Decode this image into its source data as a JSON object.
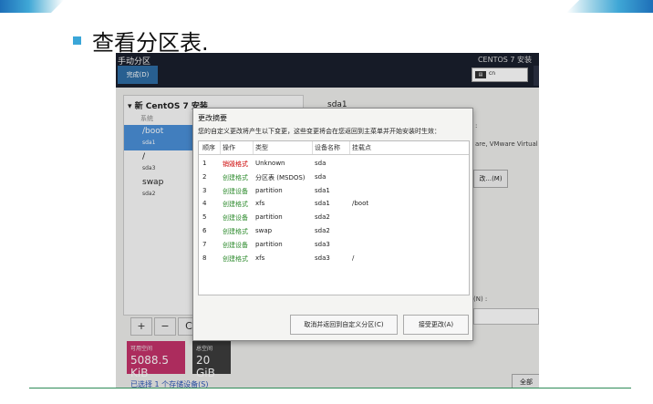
{
  "slide": {
    "title": "查看分区表."
  },
  "installer": {
    "window_title": "手动分区",
    "done_label": "完成(D)",
    "product": "CENTOS 7 安装",
    "keyboard": {
      "icon": "keyboard-icon",
      "layout": "cn"
    },
    "left_panel": {
      "header": "▾ 新 CentOS 7 安装",
      "system_label": "系统",
      "mountpoints": [
        {
          "name": "/boot",
          "device": "sda1",
          "selected": true
        },
        {
          "name": "/",
          "device": "sda3",
          "selected": false
        },
        {
          "name": "swap",
          "device": "sda2",
          "selected": false
        }
      ],
      "tools": [
        "+",
        "−",
        "C"
      ]
    },
    "available_space": {
      "label": "可用空间",
      "value": "5088.5 KiB"
    },
    "total_space": {
      "label": "总空间",
      "value": "20 GiB"
    },
    "storage_link": "已选择 1 个存储设备(S)",
    "right_panel": {
      "heading": "sda1",
      "fragment_1": ":",
      "fragment_2": "are, VMware Virtual",
      "modify_button": "改...(M)",
      "fragment_3": "(N) :",
      "bottom_button": "全部"
    },
    "dialog": {
      "title": "更改摘要",
      "description": "您的自定义更改将产生以下变更，这些变更将会在您返回到主菜单并开始安装时生效：",
      "columns": [
        "顺序",
        "操作",
        "类型",
        "设备名称",
        "挂载点"
      ],
      "rows": [
        {
          "order": "1",
          "action": "销毁格式",
          "action_kind": "delete",
          "type": "Unknown",
          "device": "sda",
          "mount": ""
        },
        {
          "order": "2",
          "action": "创建格式",
          "action_kind": "create",
          "type": "分区表 (MSDOS)",
          "device": "sda",
          "mount": ""
        },
        {
          "order": "3",
          "action": "创建设备",
          "action_kind": "create",
          "type": "partition",
          "device": "sda1",
          "mount": ""
        },
        {
          "order": "4",
          "action": "创建格式",
          "action_kind": "create",
          "type": "xfs",
          "device": "sda1",
          "mount": "/boot"
        },
        {
          "order": "5",
          "action": "创建设备",
          "action_kind": "create",
          "type": "partition",
          "device": "sda2",
          "mount": ""
        },
        {
          "order": "6",
          "action": "创建格式",
          "action_kind": "create",
          "type": "swap",
          "device": "sda2",
          "mount": ""
        },
        {
          "order": "7",
          "action": "创建设备",
          "action_kind": "create",
          "type": "partition",
          "device": "sda3",
          "mount": ""
        },
        {
          "order": "8",
          "action": "创建格式",
          "action_kind": "create",
          "type": "xfs",
          "device": "sda3",
          "mount": "/"
        }
      ],
      "cancel_label": "取消并返回到自定义分区(C)",
      "accept_label": "接受更改(A)"
    }
  },
  "colors": {
    "delete_action": "#cc0000",
    "create_action": "#2e8b2e",
    "selected_mountpoint": "#4a90d9",
    "available_space_bg": "#c4336a",
    "topbar": "#1a1f2d"
  }
}
